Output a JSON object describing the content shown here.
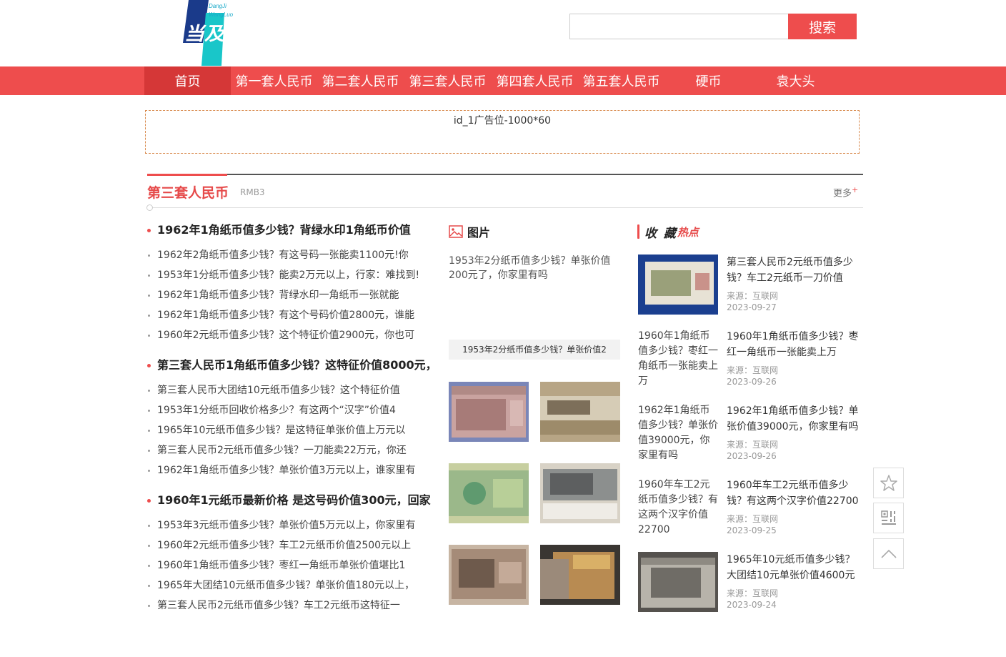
{
  "header": {
    "logo_main": "当及网络",
    "logo_en_1": "DangJi",
    "logo_en_2": "WangLuo",
    "search_placeholder": "",
    "search_button": "搜索"
  },
  "nav": {
    "items": [
      {
        "label": "首页",
        "active": true
      },
      {
        "label": "第一套人民币"
      },
      {
        "label": "第二套人民币"
      },
      {
        "label": "第三套人民币"
      },
      {
        "label": "第四套人民币"
      },
      {
        "label": "第五套人民币"
      },
      {
        "label": "硬币"
      },
      {
        "label": "袁大头"
      }
    ]
  },
  "ad": {
    "text": "id_1广告位-1000*60"
  },
  "section": {
    "title": "第三套人民币",
    "subtitle": "RMB3",
    "more": "更多",
    "more_mark": "+"
  },
  "left": {
    "groups": [
      {
        "headline": "1962年1角纸币值多少钱？背绿水印1角纸币价值",
        "items": [
          "1962年2角纸币值多少钱？有这号码一张能卖1100元!你",
          "1953年1分纸币值多少钱？能卖2万元以上，行家：难找到!",
          "1962年1角纸币值多少钱？背绿水印一角纸币一张就能",
          "1962年1角纸币值多少钱？有这个号码价值2800元，谁能",
          "1960年2元纸币值多少钱？这个特征价值2900元，你也可"
        ]
      },
      {
        "headline": "第三套人民币1角纸币值多少钱？这特征价值8000元，",
        "items": [
          "第三套人民币大团结10元纸币值多少钱？这个特征价值",
          "1953年1分纸币回收价格多少？有这两个“汉字”价值4",
          "1965年10元纸币值多少钱？是这特征单张价值上万元以",
          "第三套人民币2元纸币值多少钱？一刀能卖22万元，你还",
          "1962年1角纸币值多少钱？单张价值3万元以上，谁家里有"
        ]
      },
      {
        "headline": "1960年1元纸币最新价格 是这号码价值300元，回家",
        "items": [
          "1953年3元纸币值多少钱？单张价值5万元以上，你家里有",
          "1960年2元纸币值多少钱？车工2元纸币价值2500元以上",
          "1960年1角纸币值多少钱？枣红一角纸币单张价值堪比1",
          "1965年大团结10元纸币值多少钱？单张价值180元以上，",
          "第三套人民币2元纸币值多少钱？车工2元纸币这特征一"
        ]
      }
    ]
  },
  "middle": {
    "heading": "图片",
    "feature_alt": "1953年2分纸币值多少钱？单张价值200元了，你家里有吗",
    "feature_caption": "1953年2分纸币值多少钱？单张价值2"
  },
  "right": {
    "heading_1": "收 藏",
    "heading_2": "热点",
    "items": [
      {
        "thumb_alt": "",
        "title": "第三套人民币2元纸币值多少钱？车工2元纸币一刀价值",
        "source": "来源：互联网",
        "date": "2023-09-27",
        "has_image": true
      },
      {
        "thumb_alt": "1960年1角纸币值多少钱？枣红一角纸币一张能卖上万",
        "title": "1960年1角纸币值多少钱？枣红一角纸币一张能卖上万",
        "source": "来源：互联网",
        "date": "2023-09-26",
        "has_image": false
      },
      {
        "thumb_alt": "1962年1角纸币值多少钱？单张价值39000元，你家里有吗",
        "title": "1962年1角纸币值多少钱？单张价值39000元，你家里有吗",
        "source": "来源：互联网",
        "date": "2023-09-26",
        "has_image": false
      },
      {
        "thumb_alt": "1960年车工2元纸币值多少钱？有这两个汉字价值22700",
        "title": "1960年车工2元纸币值多少钱？有这两个汉字价值22700",
        "source": "来源：互联网",
        "date": "2023-09-25",
        "has_image": false
      },
      {
        "thumb_alt": "",
        "title": "1965年10元纸币值多少钱？大团结10元单张价值4600元",
        "source": "来源：互联网",
        "date": "2023-09-24",
        "has_image": true
      }
    ]
  },
  "colors": {
    "brand_red": "#ee4d4d",
    "nav_active": "#d53737",
    "logo_blue": "#1a3a8a",
    "logo_cyan": "#19c6c9"
  }
}
